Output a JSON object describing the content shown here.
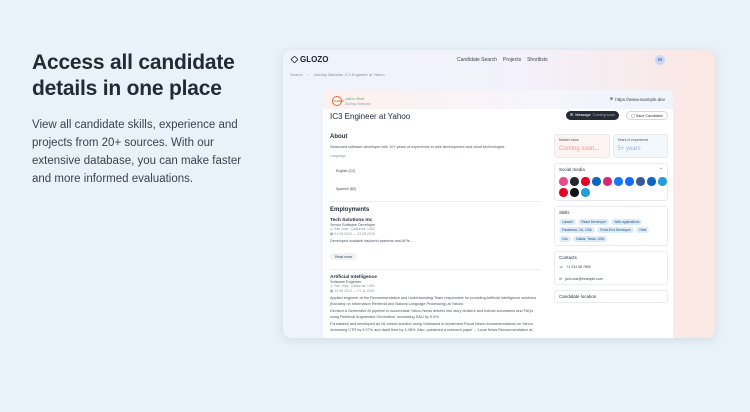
{
  "hero": {
    "title": "Access all candidate details in one place",
    "body": "View all candidate skills, experience and projects from 20+ sources. With our extensive database, you can make faster and more informed evaluations."
  },
  "nav": {
    "logo": "GLOZO",
    "links": [
      "Candidate Search",
      "Projects",
      "Shortlists"
    ],
    "avatar": "M"
  },
  "breadcrumb": [
    "Search",
    "Akshay Bahadur IC3 Engineer at Yahoo"
  ],
  "header": {
    "status": "Just In Work",
    "name": "Akshay Bahadur",
    "logo_text": "YAHOO",
    "website": "https://www.example.dev"
  },
  "candidate": {
    "title": "IC3 Engineer at Yahoo",
    "message_label": "Message",
    "message_sub": "Coming soon",
    "save_label": "Save Candidate"
  },
  "about": {
    "heading": "About",
    "text": "Seasoned software developer with 10+ years of experience in web development and cloud technologies.",
    "language_label": "Language",
    "languages": [
      "English (C2)",
      "Spanish (B2)"
    ]
  },
  "employments": {
    "heading": "Employments",
    "read_more": "Read more",
    "jobs": [
      {
        "company": "Tech Solutions Inc",
        "role": "Senior Software Developer",
        "location": "San Jose, California, USA",
        "dates": "01.06.2015 — 24.08.2020",
        "desc": "Developed scalable backend systems and APIs..."
      },
      {
        "company": "Artificial Intelligence",
        "role": "Software Engineer",
        "location": "San Jose, California, USA",
        "dates": "22.08.2015 — 27.11.2020",
        "desc1": "Applied engineer at the Recommendation and Understanding Team responsible for providing Artificial Intelligence solutions (focusing on Information Retrieval and Natural Language Processing) at Yahoo!",
        "desc2": "Devised a Generative AI pipeline to accumulate Yahoo News articles into story clusters and extract summaries and FAQs using Retrieval Augmented Generation, increasing DAU by 5.3%.",
        "desc3": "Formalized and developed an NL-based solution using Yolkbased to implement Fiscal News recommendations on Yahoo, increasing CTR by 4.07% and dwell time by 1.08%. Also, published a research paper – 'Local News Recommendation at..."
      }
    ]
  },
  "sidebar": {
    "market_label": "Market value",
    "market_value": "Coming soon...",
    "years_label": "Years of experience",
    "years_value": "5+ years",
    "social_heading": "Social media",
    "social_icons": [
      {
        "name": "dribbble-icon",
        "color": "#ea4c89"
      },
      {
        "name": "github-icon",
        "color": "#24292e"
      },
      {
        "name": "pinterest-icon",
        "color": "#e60023"
      },
      {
        "name": "linkedin-icon",
        "color": "#0a66c2"
      },
      {
        "name": "instagram-icon",
        "color": "#d62976"
      },
      {
        "name": "facebook-icon",
        "color": "#1877f2"
      },
      {
        "name": "behance-icon",
        "color": "#1769ff"
      },
      {
        "name": "facebook-icon-2",
        "color": "#3b5998"
      },
      {
        "name": "linkedin-icon-2",
        "color": "#0a66c2"
      },
      {
        "name": "telegram-icon",
        "color": "#229ed9"
      },
      {
        "name": "pinterest-icon-2",
        "color": "#e60023"
      },
      {
        "name": "tiktok-icon",
        "color": "#111111"
      },
      {
        "name": "telegram-icon-2",
        "color": "#229ed9"
      }
    ],
    "skills_heading": "Skills",
    "skills": [
      "Laravel",
      "React Developer",
      "Web applications",
      "Pasadena, CA, USA",
      "Front-End Developer",
      "Html",
      "Css",
      "Dallas, Texas, USA"
    ],
    "contacts_heading": "Contacts",
    "phone": "+1 234 56 7890",
    "email": "john.doe@example.com",
    "location_heading": "Candidate location"
  }
}
